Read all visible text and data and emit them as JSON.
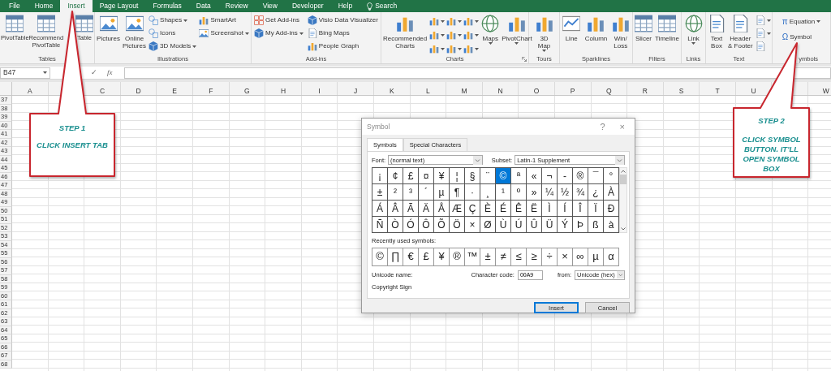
{
  "tabs": [
    {
      "label": "File",
      "selected": false
    },
    {
      "label": "Home",
      "selected": false
    },
    {
      "label": "Insert",
      "selected": true
    },
    {
      "label": "Page Layout",
      "selected": false
    },
    {
      "label": "Formulas",
      "selected": false
    },
    {
      "label": "Data",
      "selected": false
    },
    {
      "label": "Review",
      "selected": false
    },
    {
      "label": "View",
      "selected": false
    },
    {
      "label": "Developer",
      "selected": false
    },
    {
      "label": "Help",
      "selected": false
    },
    {
      "label": "Search",
      "selected": false,
      "kind": "search"
    }
  ],
  "ribbon_groups": [
    {
      "label": "Tables",
      "items": [
        {
          "kind": "large",
          "lines": [
            "PivotTable"
          ]
        },
        {
          "kind": "large",
          "lines": [
            "Recommend",
            "PivotTable"
          ]
        },
        {
          "kind": "large",
          "lines": [
            "Table"
          ]
        }
      ]
    },
    {
      "label": "Illustrations",
      "items": [
        {
          "kind": "large",
          "lines": [
            "Pictures"
          ]
        },
        {
          "kind": "large",
          "lines": [
            "Online",
            "Pictures"
          ]
        },
        {
          "kind": "stack",
          "items": [
            {
              "kind": "small",
              "label": "Shapes",
              "dropdown": true
            },
            {
              "kind": "small",
              "label": "Icons"
            },
            {
              "kind": "small",
              "label": "3D Models",
              "dropdown": true
            }
          ]
        },
        {
          "kind": "stack",
          "items": [
            {
              "kind": "small",
              "label": "SmartArt"
            },
            {
              "kind": "small",
              "label": "Screenshot",
              "dropdown": true
            }
          ]
        }
      ]
    },
    {
      "label": "Add-ins",
      "items": [
        {
          "kind": "stack",
          "items": [
            {
              "kind": "small",
              "label": "Get Add-ins"
            },
            {
              "kind": "small",
              "label": "My Add-ins",
              "dropdown": true
            }
          ]
        },
        {
          "kind": "stack",
          "items": [
            {
              "kind": "small",
              "label": "Visio Data Visualizer"
            },
            {
              "kind": "small",
              "label": "Bing Maps"
            },
            {
              "kind": "small",
              "label": "People Graph"
            }
          ]
        }
      ]
    },
    {
      "label": "Charts",
      "launcher": true,
      "items": [
        {
          "kind": "large",
          "lines": [
            "Recommended",
            "Charts"
          ]
        },
        {
          "kind": "grid",
          "items": [
            {
              "kind": "icon",
              "dropdown": true
            },
            {
              "kind": "icon",
              "dropdown": true
            },
            {
              "kind": "icon",
              "dropdown": true
            },
            {
              "kind": "icon",
              "dropdown": true
            },
            {
              "kind": "icon",
              "dropdown": true
            },
            {
              "kind": "icon",
              "dropdown": true
            },
            {
              "kind": "icon",
              "dropdown": true
            },
            {
              "kind": "icon",
              "dropdown": true
            },
            {
              "kind": "icon",
              "dropdown": true
            }
          ]
        },
        {
          "kind": "large",
          "lines": [
            "Maps"
          ],
          "dropdown": true
        },
        {
          "kind": "large",
          "lines": [
            "PivotChart"
          ],
          "dropdown": true
        }
      ]
    },
    {
      "label": "Tours",
      "items": [
        {
          "kind": "large",
          "lines": [
            "3D",
            "Map"
          ],
          "dropdown": true
        }
      ]
    },
    {
      "label": "Sparklines",
      "items": [
        {
          "kind": "large",
          "lines": [
            "Line"
          ]
        },
        {
          "kind": "large",
          "lines": [
            "Column"
          ]
        },
        {
          "kind": "large",
          "lines": [
            "Win/",
            "Loss"
          ]
        }
      ]
    },
    {
      "label": "Filters",
      "items": [
        {
          "kind": "large",
          "lines": [
            "Slicer"
          ]
        },
        {
          "kind": "large",
          "lines": [
            "Timeline"
          ]
        }
      ]
    },
    {
      "label": "Links",
      "items": [
        {
          "kind": "large",
          "lines": [
            "Link"
          ],
          "dropdown": true
        }
      ]
    },
    {
      "label": "Text",
      "items": [
        {
          "kind": "large",
          "lines": [
            "Text",
            "Box"
          ]
        },
        {
          "kind": "large",
          "lines": [
            "Header",
            "& Footer"
          ]
        },
        {
          "kind": "stack",
          "items": [
            {
              "kind": "icon",
              "dropdown": true
            },
            {
              "kind": "icon",
              "dropdown": true
            },
            {
              "kind": "icon"
            }
          ]
        }
      ]
    },
    {
      "label": "ymbols",
      "items": [
        {
          "kind": "stack",
          "items": [
            {
              "kind": "glyph",
              "glyph": "π",
              "label": "Equation",
              "dropdown": true
            },
            {
              "kind": "glyph",
              "glyph": "Ω",
              "label": "Symbol"
            }
          ]
        }
      ]
    }
  ],
  "formula_bar": {
    "name_box": "B47",
    "enter": "✓",
    "function": "fx"
  },
  "columns": [
    {
      "label": "A"
    },
    {},
    {
      "label": "C"
    },
    {
      "label": "D"
    },
    {
      "label": "E"
    },
    {
      "label": "F"
    },
    {
      "label": "G"
    },
    {
      "label": "H"
    },
    {
      "label": "I"
    },
    {
      "label": "J"
    },
    {
      "label": "K"
    },
    {
      "label": "L"
    },
    {
      "label": "M"
    },
    {
      "label": "N"
    },
    {
      "label": "O"
    },
    {
      "label": "P"
    },
    {
      "label": "Q"
    },
    {
      "label": "R"
    },
    {
      "label": "S"
    },
    {
      "label": "T"
    },
    {
      "label": "U"
    },
    {},
    {
      "label": "W"
    }
  ],
  "rows": [
    "37",
    "38",
    "39",
    "40",
    "41",
    "42",
    "43",
    "44",
    "45",
    "46",
    "47",
    "48",
    "49",
    "50",
    "51",
    "52",
    "53",
    "54",
    "55",
    "56",
    "57",
    "58",
    "59",
    "60",
    "61",
    "62",
    "63",
    "64",
    "65",
    "66",
    "67",
    "68"
  ],
  "dialog": {
    "title": "Symbol",
    "help": "?",
    "close": "×",
    "tabs": [
      {
        "label": "Symbols",
        "selected": true
      },
      {
        "label": "Special Characters",
        "selected": false
      }
    ],
    "font_label": "Font:",
    "font": "(normal text)",
    "subset_label": "Subset:",
    "subset": "Latin-1 Supplement",
    "symbols": [
      {
        "char": "¡",
        "selected": false
      },
      {
        "char": "¢",
        "selected": false
      },
      {
        "char": "£",
        "selected": false
      },
      {
        "char": "¤",
        "selected": false
      },
      {
        "char": "¥",
        "selected": false
      },
      {
        "char": "¦",
        "selected": false
      },
      {
        "char": "§",
        "selected": false
      },
      {
        "char": "¨",
        "selected": false
      },
      {
        "char": "©",
        "selected": true
      },
      {
        "char": "ª",
        "selected": false
      },
      {
        "char": "«",
        "selected": false
      },
      {
        "char": "¬",
        "selected": false
      },
      {
        "char": "-",
        "selected": false
      },
      {
        "char": "®",
        "selected": false
      },
      {
        "char": "¯",
        "selected": false
      },
      {
        "char": "°",
        "selected": false
      },
      {
        "char": "±",
        "selected": false
      },
      {
        "char": "²",
        "selected": false
      },
      {
        "char": "³",
        "selected": false
      },
      {
        "char": "´",
        "selected": false
      },
      {
        "char": "µ",
        "selected": false
      },
      {
        "char": "¶",
        "selected": false
      },
      {
        "char": "·",
        "selected": false
      },
      {
        "char": "¸",
        "selected": false
      },
      {
        "char": "¹",
        "selected": false
      },
      {
        "char": "º",
        "selected": false
      },
      {
        "char": "»",
        "selected": false
      },
      {
        "char": "¼",
        "selected": false
      },
      {
        "char": "½",
        "selected": false
      },
      {
        "char": "¾",
        "selected": false
      },
      {
        "char": "¿",
        "selected": false
      },
      {
        "char": "À",
        "selected": false
      },
      {
        "char": "Á",
        "selected": false
      },
      {
        "char": "Â",
        "selected": false
      },
      {
        "char": "Ã",
        "selected": false
      },
      {
        "char": "Ä",
        "selected": false
      },
      {
        "char": "Å",
        "selected": false
      },
      {
        "char": "Æ",
        "selected": false
      },
      {
        "char": "Ç",
        "selected": false
      },
      {
        "char": "È",
        "selected": false
      },
      {
        "char": "É",
        "selected": false
      },
      {
        "char": "Ê",
        "selected": false
      },
      {
        "char": "Ë",
        "selected": false
      },
      {
        "char": "Ì",
        "selected": false
      },
      {
        "char": "Í",
        "selected": false
      },
      {
        "char": "Î",
        "selected": false
      },
      {
        "char": "Ï",
        "selected": false
      },
      {
        "char": "Ð",
        "selected": false
      },
      {
        "char": "Ñ",
        "selected": false
      },
      {
        "char": "Ò",
        "selected": false
      },
      {
        "char": "Ó",
        "selected": false
      },
      {
        "char": "Ô",
        "selected": false
      },
      {
        "char": "Õ",
        "selected": false
      },
      {
        "char": "Ö",
        "selected": false
      },
      {
        "char": "×",
        "selected": false
      },
      {
        "char": "Ø",
        "selected": false
      },
      {
        "char": "Ù",
        "selected": false
      },
      {
        "char": "Ú",
        "selected": false
      },
      {
        "char": "Û",
        "selected": false
      },
      {
        "char": "Ü",
        "selected": false
      },
      {
        "char": "Ý",
        "selected": false
      },
      {
        "char": "Þ",
        "selected": false
      },
      {
        "char": "ß",
        "selected": false
      },
      {
        "char": "à",
        "selected": false
      }
    ],
    "recent_label": "Recently used symbols:",
    "recent": [
      "©",
      "∏",
      "€",
      "£",
      "¥",
      "®",
      "™",
      "±",
      "≠",
      "≤",
      "≥",
      "÷",
      "×",
      "∞",
      "µ",
      "α"
    ],
    "unicode_name_label": "Unicode name:",
    "unicode_name": "Copyright Sign",
    "char_code_label": "Character code:",
    "char_code": "00A9",
    "from_label": "from:",
    "from": "Unicode (hex)",
    "buttons": [
      {
        "label": "Insert",
        "kind": "default"
      },
      {
        "label": "Cancel",
        "kind": "normal"
      }
    ]
  },
  "callouts": [
    {
      "title": "STEP 1",
      "text": "CLICK INSERT TAB"
    },
    {
      "title": "STEP 2",
      "text": "CLICK SYMBOL BUTTON. IT'LL OPEN SYMBOL BOX"
    }
  ]
}
